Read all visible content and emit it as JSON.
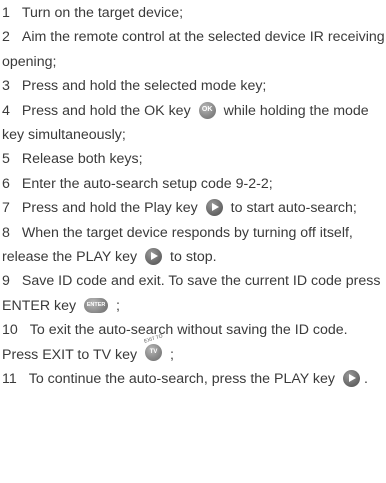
{
  "steps": [
    {
      "num": "1",
      "text": "Turn on the target device;"
    },
    {
      "num": "2",
      "text": "Aim the remote control at the selected device IR receiving opening;"
    },
    {
      "num": "3",
      "text": "Press and hold the selected mode key;"
    },
    {
      "num": "4",
      "text_a": "Press and hold the OK key",
      "text_b": "while holding the mode key simultaneously;"
    },
    {
      "num": "5",
      "text": "Release both keys;"
    },
    {
      "num": "6",
      "text": "Enter the auto-search setup code 9-2-2;"
    },
    {
      "num": "7",
      "text_a": "Press and hold the Play key",
      "text_b": "to start auto-search;"
    },
    {
      "num": "8",
      "text_a": "When the target device responds by turning off itself, release the PLAY key",
      "text_b": "to stop."
    },
    {
      "num": "9",
      "text_a": "Save ID code and exit. To save the current ID code press ENTER key",
      "text_b": ";"
    },
    {
      "num": "10",
      "text_a": "To exit the auto-search without saving the ID code. Press EXIT to TV key",
      "text_b": ";"
    },
    {
      "num": "11",
      "text_a": "To continue the auto-search, press the PLAY key",
      "text_b": "."
    }
  ],
  "icons": {
    "ok": "ok-key-icon",
    "play": "play-key-icon",
    "enter": "enter-key-icon",
    "exit_to_tv": "exit-to-tv-key-icon"
  }
}
